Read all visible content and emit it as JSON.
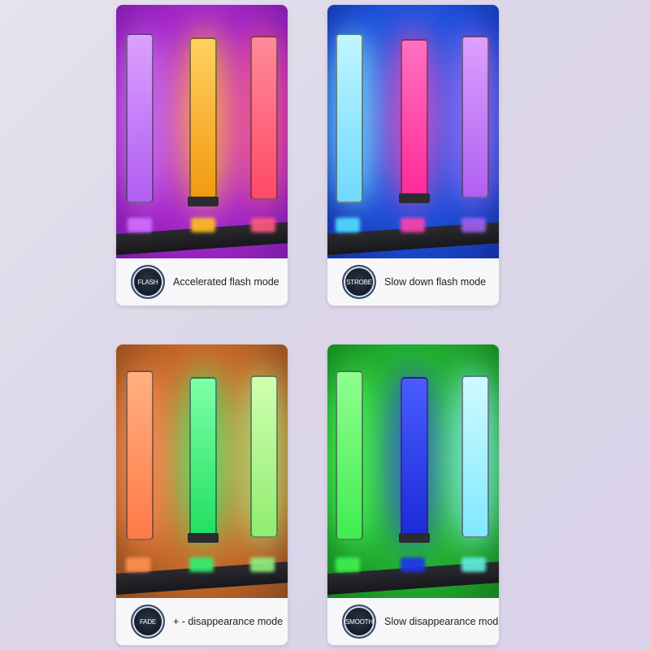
{
  "cards": [
    {
      "badge": "FLASH",
      "label": "Accelerated flash mode",
      "background": "#b030d0",
      "bar_colors": [
        "#c070f0",
        "#f2a81a",
        "#ff5a72"
      ]
    },
    {
      "badge": "STROBE",
      "label": "Slow down flash mode",
      "background": "#1f6fe0",
      "bar_colors": [
        "#7fe0ff",
        "#ff3aa8",
        "#c070f5"
      ]
    },
    {
      "badge": "FADE",
      "label": "+ - disappearance mode",
      "background": "#d87828",
      "bar_colors": [
        "#ff8a55",
        "#2bef6a",
        "#9cf27a"
      ]
    },
    {
      "badge": "SMOOTH",
      "label": "Slow disappearance mode",
      "background": "#22c030",
      "bar_colors": [
        "#42f05a",
        "#2438e8",
        "#8ef0ff"
      ]
    }
  ]
}
